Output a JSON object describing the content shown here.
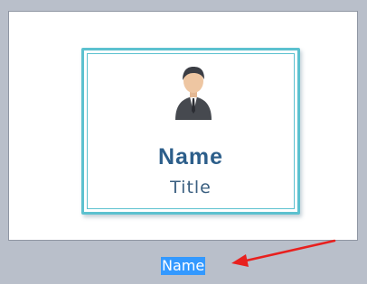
{
  "card": {
    "name": "Name",
    "title": "Title",
    "avatar_icon": "person-avatar-icon",
    "border_color": "#5cc1cf",
    "name_color": "#2c5e8a"
  },
  "label_field": {
    "value": "Name",
    "selection_color": "#3399ff"
  },
  "annotation": {
    "icon": "red-arrow-icon",
    "color": "#e8201e"
  }
}
